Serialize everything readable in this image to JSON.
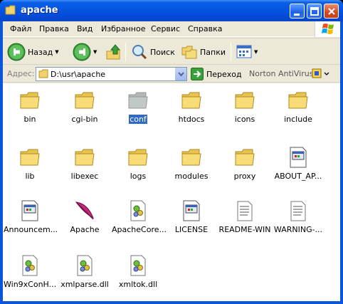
{
  "window": {
    "title": "apache"
  },
  "menu": {
    "items": [
      "Файл",
      "Правка",
      "Вид",
      "Избранное",
      "Сервис",
      "Справка"
    ]
  },
  "toolbar": {
    "back_label": "Назад",
    "search_label": "Поиск",
    "folders_label": "Папки"
  },
  "address": {
    "label": "Адрес:",
    "value": "D:\\usr\\apache",
    "go_label": "Переход",
    "norton_label": "Norton AntiVirus"
  },
  "files": [
    {
      "name": "bin",
      "type": "folder"
    },
    {
      "name": "cgi-bin",
      "type": "folder"
    },
    {
      "name": "conf",
      "type": "folder",
      "selected": true
    },
    {
      "name": "htdocs",
      "type": "folder"
    },
    {
      "name": "icons",
      "type": "folder"
    },
    {
      "name": "include",
      "type": "folder"
    },
    {
      "name": "lib",
      "type": "folder"
    },
    {
      "name": "libexec",
      "type": "folder"
    },
    {
      "name": "logs",
      "type": "folder"
    },
    {
      "name": "modules",
      "type": "folder"
    },
    {
      "name": "proxy",
      "type": "folder"
    },
    {
      "name": "ABOUT_AP...",
      "type": "document"
    },
    {
      "name": "Announcem...",
      "type": "document"
    },
    {
      "name": "Apache",
      "type": "feather"
    },
    {
      "name": "ApacheCore...",
      "type": "dll"
    },
    {
      "name": "LICENSE",
      "type": "document"
    },
    {
      "name": "README-WIN",
      "type": "text"
    },
    {
      "name": "WARNING-...",
      "type": "text"
    },
    {
      "name": "Win9xConH...",
      "type": "dll"
    },
    {
      "name": "xmlparse.dll",
      "type": "dll"
    },
    {
      "name": "xmltok.dll",
      "type": "dll"
    }
  ]
}
